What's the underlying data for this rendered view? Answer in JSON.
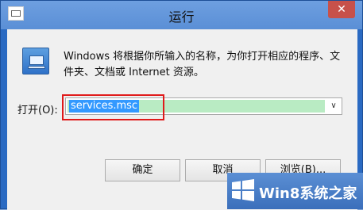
{
  "window": {
    "title": "运行",
    "close_glyph": "✕"
  },
  "content": {
    "description": "Windows 将根据你所输入的名称，为你打开相应的程序、文件夹、文档或 Internet 资源。",
    "open_label": "打开(O):",
    "open_value": "services.msc",
    "dropdown_glyph": "∨"
  },
  "buttons": {
    "ok": "确定",
    "cancel": "取消",
    "browse": "浏览(B)..."
  },
  "watermark": {
    "text": "Win8系统之家"
  },
  "colors": {
    "titlebar": "#6e9fe0",
    "close": "#c7514a",
    "selection": "#3399ff",
    "input_highlight": "#b9ebc3",
    "annotation": "#e01a1a"
  },
  "icons": [
    "system-menu-icon",
    "run-program-icon",
    "windows-logo-icon"
  ]
}
